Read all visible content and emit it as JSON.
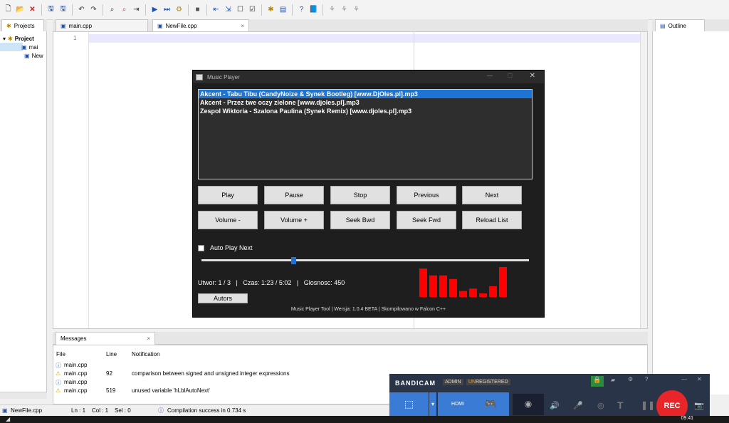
{
  "toolbar": {
    "icons": [
      "new-file",
      "open-folder",
      "close",
      "save",
      "save-all",
      "undo",
      "redo",
      "find",
      "find-replace",
      "goto-line",
      "run",
      "run-to-cursor",
      "debug",
      "stop",
      "step-back",
      "step-into",
      "step-over",
      "step-out",
      "compile",
      "component",
      "help",
      "book",
      "tool1",
      "tool2",
      "tool3"
    ]
  },
  "left_panel": {
    "tab_label": "Projects",
    "tree": [
      {
        "label": "Project",
        "bold": true
      },
      {
        "label": "mai"
      },
      {
        "label": "New"
      }
    ]
  },
  "editor": {
    "tabs": [
      {
        "label": "main.cpp",
        "active": false
      },
      {
        "label": "NewFile.cpp",
        "active": true
      }
    ],
    "line_number": "1"
  },
  "right_panel": {
    "tab_label": "Outline"
  },
  "music_player": {
    "title": "Music Player",
    "playlist": [
      "Akcent - Tabu Tibu (CandyNoize & Synek Bootleg) [www.DjOles.pl].mp3",
      "Akcent - Przez twe oczy zielone [www.djoles.pl].mp3",
      "Zespol Wiktoria - Szalona Paulina (Synek Remix) [www.djoles.pl].mp3"
    ],
    "selected_index": 0,
    "buttons_row1": [
      "Play",
      "Pause",
      "Stop",
      "Previous",
      "Next"
    ],
    "buttons_row2": [
      "Volume -",
      "Volume +",
      "Seek Bwd",
      "Seek Fwd",
      "Reload List"
    ],
    "auto_play_label": "Auto Play Next",
    "auto_play_checked": false,
    "seek_position": 0.28,
    "status_text": "Utwor: 1 / 3   |   Czas: 1:23 / 5:02   |   Glosnosc: 450",
    "visualizer_levels": [
      0.95,
      0.72,
      0.72,
      0.6,
      0.2,
      0.28,
      0.12,
      0.36,
      1.0
    ],
    "visualizer_color": "#ff0000",
    "autors_label": "Autors",
    "footer": "Music Player Tool | Wersja: 1.0.4 BETA | Skompilowano w Falcon C++"
  },
  "messages": {
    "tab_label": "Messages",
    "columns": [
      "File",
      "Line",
      "Notification"
    ],
    "rows": [
      {
        "type": "info",
        "file": "main.cpp",
        "line": "",
        "note": ""
      },
      {
        "type": "warning",
        "file": "main.cpp",
        "line": "92",
        "note": "comparison between signed and unsigned integer expressions"
      },
      {
        "type": "info",
        "file": "main.cpp",
        "line": "",
        "note": ""
      },
      {
        "type": "warning",
        "file": "main.cpp",
        "line": "519",
        "note": "unused variable 'hLblAutoNext'"
      }
    ]
  },
  "status_bar": {
    "file": "NewFile.cpp",
    "ln": "Ln : 1",
    "col": "Col : 1",
    "sel": "Sel : 0",
    "message": "Compilation success in 0.734 s"
  },
  "bandicam": {
    "brand": "BANDICAM",
    "admin": "ADMIN",
    "unregistered_un": "UN",
    "unregistered_rest": "REGISTERED",
    "rec_label": "REC",
    "mode_label": "HDMI"
  },
  "taskbar": {
    "clock": "09:41"
  },
  "colors": {
    "selection": "#1e74d4",
    "bandicam_bg": "#2a3448",
    "rec": "#e8262a"
  }
}
